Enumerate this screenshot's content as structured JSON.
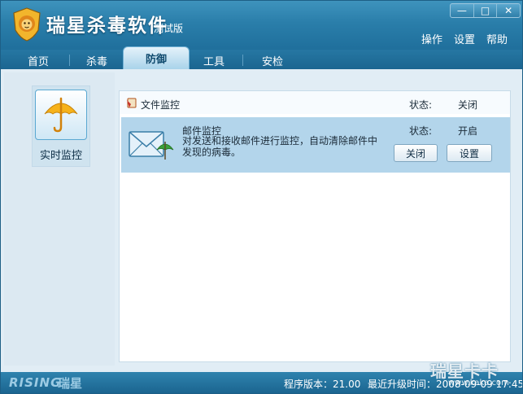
{
  "app": {
    "title": "瑞星杀毒软件",
    "subtitle": "测试版",
    "window_controls": [
      "—",
      "□",
      "✕"
    ],
    "menu": [
      "操作",
      "设置",
      "帮助"
    ]
  },
  "tabs": [
    {
      "label": "首页",
      "active": false
    },
    {
      "label": "杀毒",
      "active": false
    },
    {
      "label": "防御",
      "active": true
    },
    {
      "label": "工具",
      "active": false
    },
    {
      "label": "安检",
      "active": false
    }
  ],
  "sidebar": {
    "items": [
      {
        "label": "实时监控",
        "icon": "umbrella-icon",
        "selected": true
      }
    ]
  },
  "monitors": {
    "file": {
      "title": "文件监控",
      "status_label": "状态:",
      "status_value": "关闭",
      "icon": "file-monitor-icon"
    },
    "mail": {
      "title": "邮件监控",
      "description": "对发送和接收邮件进行监控，自动清除邮件中发现的病毒。",
      "status_label": "状态:",
      "status_value": "开启",
      "icon": "mail-monitor-icon",
      "close_label": "关闭",
      "settings_label": "设置"
    }
  },
  "statusbar": {
    "brand_en": "RISING",
    "brand_cn": "瑞星",
    "version": "程序版本：21.00",
    "last_update": "最近升级时间：2008-09-09 17:45"
  },
  "watermark": {
    "text": "瑞星卡卡",
    "url": "www.kaka.com"
  },
  "colors": {
    "titlebar": "#2a7eaa",
    "tab_active": "#a9d3ea",
    "selected_row": "#b3d5eb",
    "statusbar": "#1b6590"
  }
}
